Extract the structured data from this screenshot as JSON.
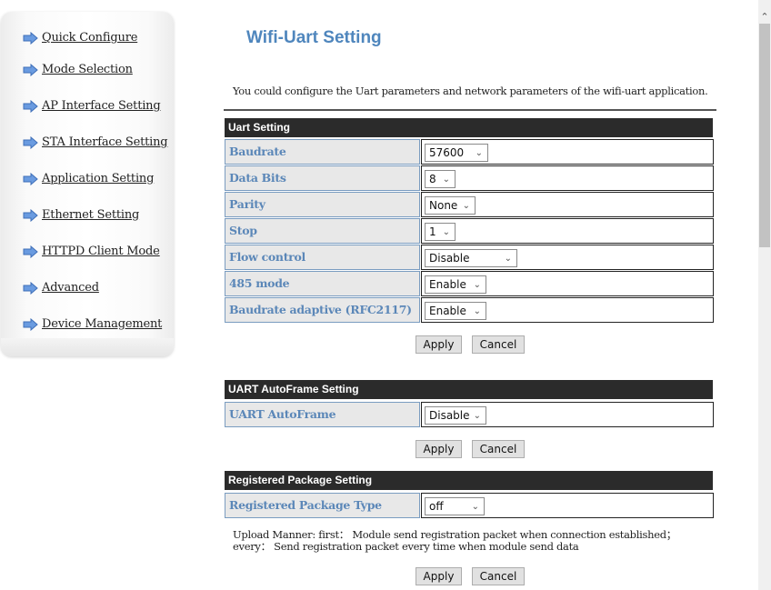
{
  "sidebar": {
    "items": [
      {
        "label": "Quick Configure",
        "icon": "arrow-right-icon"
      },
      {
        "label": "Mode Selection",
        "icon": "arrow-right-icon"
      },
      {
        "label": "AP Interface Setting",
        "icon": "arrow-right-icon"
      },
      {
        "label": "STA Interface Setting",
        "icon": "arrow-right-icon"
      },
      {
        "label": "Application Setting",
        "icon": "arrow-right-icon"
      },
      {
        "label": "Ethernet Setting",
        "icon": "arrow-right-icon"
      },
      {
        "label": "HTTPD Client Mode",
        "icon": "arrow-right-icon"
      },
      {
        "label": "Advanced",
        "icon": "arrow-right-icon"
      },
      {
        "label": "Device Management",
        "icon": "arrow-right-icon"
      }
    ]
  },
  "page": {
    "title": "Wifi-Uart Setting",
    "description": "You could configure the Uart parameters and network parameters of the wifi-uart application."
  },
  "uart_setting": {
    "header": "Uart Setting",
    "rows": [
      {
        "label": "Baudrate",
        "value": "57600"
      },
      {
        "label": "Data Bits",
        "value": "8"
      },
      {
        "label": "Parity",
        "value": "None"
      },
      {
        "label": "Stop",
        "value": "1"
      },
      {
        "label": "Flow control",
        "value": "Disable"
      },
      {
        "label": "485 mode",
        "value": "Enable"
      },
      {
        "label": "Baudrate adaptive (RFC2117)",
        "value": "Enable"
      }
    ],
    "apply_label": "Apply",
    "cancel_label": "Cancel"
  },
  "autoframe_setting": {
    "header": "UART AutoFrame Setting",
    "rows": [
      {
        "label": "UART AutoFrame",
        "value": "Disable"
      }
    ],
    "apply_label": "Apply",
    "cancel_label": "Cancel"
  },
  "registered_package_setting": {
    "header": "Registered Package Setting",
    "rows": [
      {
        "label": "Registered Package Type",
        "value": "off"
      }
    ],
    "note": "Upload Manner: first： Module send registration packet when connection established； every： Send registration packet every time when module send data",
    "apply_label": "Apply",
    "cancel_label": "Cancel"
  },
  "colors": {
    "title": "#4f86bd",
    "label_text": "#5b87b8",
    "section_header_bg": "#2b2b2b",
    "label_bg": "#e8e8e8"
  }
}
